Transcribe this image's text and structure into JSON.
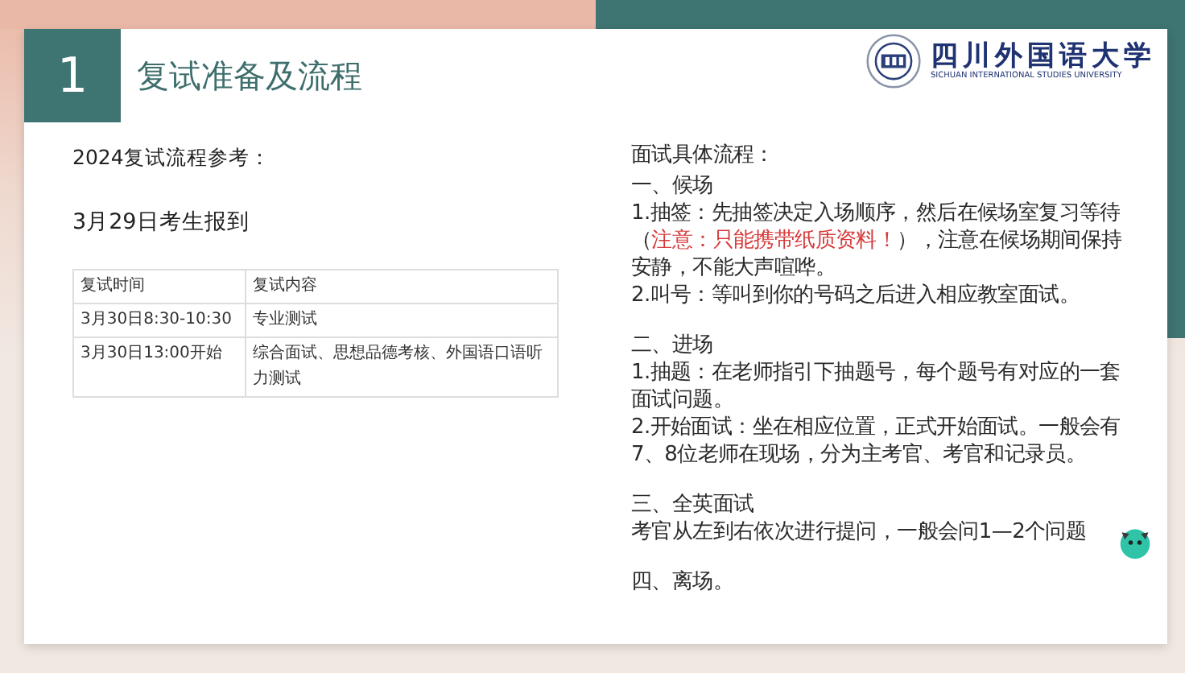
{
  "slide": {
    "number": "1",
    "title": "复试准备及流程"
  },
  "logo": {
    "name": "四川外国语大学",
    "subtitle": "SICHUAN INTERNATIONAL STUDIES UNIVERSITY"
  },
  "left": {
    "heading": "2024复试流程参考：",
    "registration": "3月29日考生报到",
    "table": {
      "columns": [
        "复试时间",
        "复试内容"
      ],
      "rows": [
        [
          "3月30日8:30-10:30",
          "专业测试"
        ],
        [
          "3月30日13:00开始",
          "综合面试、思想品德考核、外国语口语听力测试"
        ]
      ]
    }
  },
  "right": {
    "heading": "面试具体流程：",
    "sections": [
      {
        "title": "一、候场",
        "paragraphs": [
          [
            {
              "kind": "normal",
              "text": "1.抽签：先抽签决定入场顺序，然后在候场室复习等待（"
            },
            {
              "kind": "warning",
              "text": "注意：只能携带纸质资料！"
            },
            {
              "kind": "normal",
              "text": "），注意在候场期间保持安静，不能大声喧哗。"
            }
          ],
          [
            {
              "kind": "normal",
              "text": "2.叫号：等叫到你的号码之后进入相应教室面试。"
            }
          ]
        ]
      },
      {
        "title": "二、进场",
        "paragraphs": [
          [
            {
              "kind": "normal",
              "text": "1.抽题：在老师指引下抽题号，每个题号有对应的一套面试问题。"
            }
          ],
          [
            {
              "kind": "normal",
              "text": "2.开始面试：坐在相应位置，正式开始面试。一般会有7、8位老师在现场，分为主考官、考官和记录员。"
            }
          ]
        ]
      },
      {
        "title": "三、全英面试",
        "paragraphs": [
          [
            {
              "kind": "normal",
              "text": "考官从左到右依次进行提问，一般会问1—2个问题"
            }
          ]
        ]
      },
      {
        "title": "四、离场。"
      }
    ]
  }
}
